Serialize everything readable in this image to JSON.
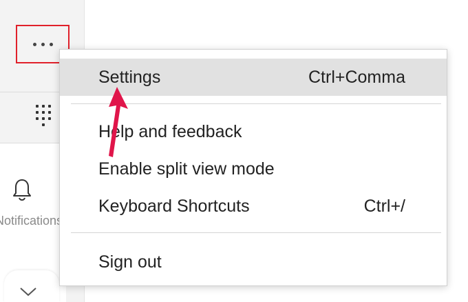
{
  "sidebar": {
    "notifications_label": "Notifications"
  },
  "menu": {
    "items": [
      {
        "label": "Settings",
        "shortcut": "Ctrl+Comma"
      },
      {
        "label": "Help and feedback",
        "shortcut": ""
      },
      {
        "label": "Enable split view mode",
        "shortcut": ""
      },
      {
        "label": "Keyboard Shortcuts",
        "shortcut": "Ctrl+/"
      },
      {
        "label": "Sign out",
        "shortcut": ""
      }
    ]
  },
  "colors": {
    "highlight_box": "#e0202a",
    "annotation_arrow": "#e0154a",
    "menu_hover": "#e1e1e1"
  },
  "icons": {
    "more": "more-options-icon",
    "dialpad": "dialpad-icon",
    "bell": "bell-icon",
    "chevron": "chevron-down-icon"
  }
}
